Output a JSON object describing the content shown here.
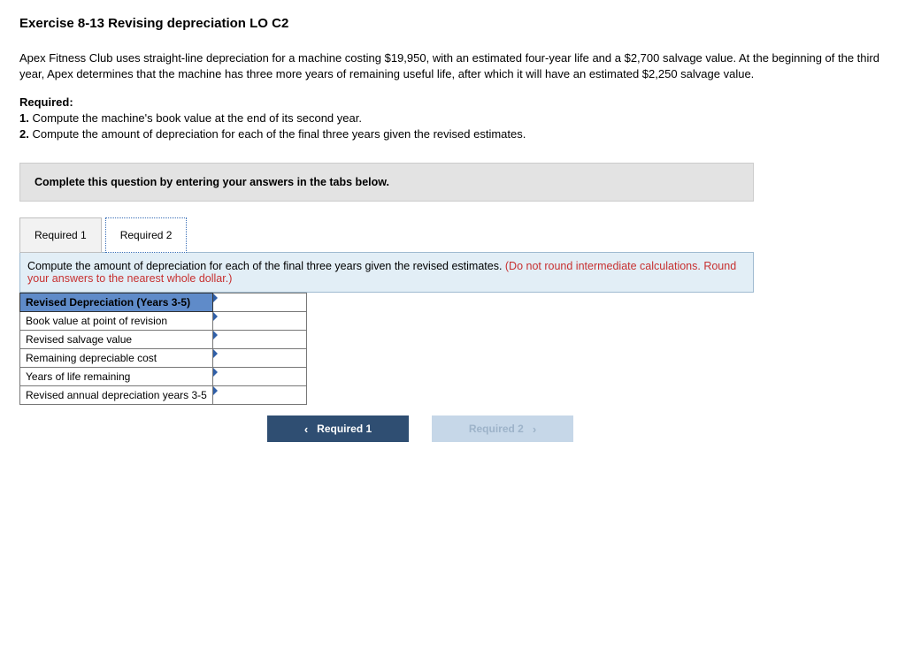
{
  "title": "Exercise 8-13 Revising depreciation LO C2",
  "body": "Apex Fitness Club uses straight-line depreciation for a machine costing $19,950, with an estimated four-year life and a $2,700 salvage value. At the beginning of the third year, Apex determines that the machine has three more years of remaining useful life, after which it will have an estimated $2,250 salvage value.",
  "required_label": "Required:",
  "requirements": [
    "Compute the machine's book value at the end of its second year.",
    "Compute the amount of depreciation for each of the final three years given the revised estimates."
  ],
  "instruction": "Complete this question by entering your answers in the tabs below.",
  "tabs": [
    "Required 1",
    "Required 2"
  ],
  "prompt_main": "Compute the amount of depreciation for each of the final three years given the revised estimates. ",
  "prompt_note": "(Do not round intermediate calculations. Round your answers to the nearest whole dollar.)",
  "table": {
    "header": "Revised Depreciation (Years 3-5)",
    "rows": [
      "Book value at point of revision",
      "Revised salvage value",
      "Remaining depreciable cost",
      "Years of life remaining",
      "Revised annual depreciation years 3-5"
    ]
  },
  "nav": {
    "prev": "Required 1",
    "next": "Required 2"
  }
}
